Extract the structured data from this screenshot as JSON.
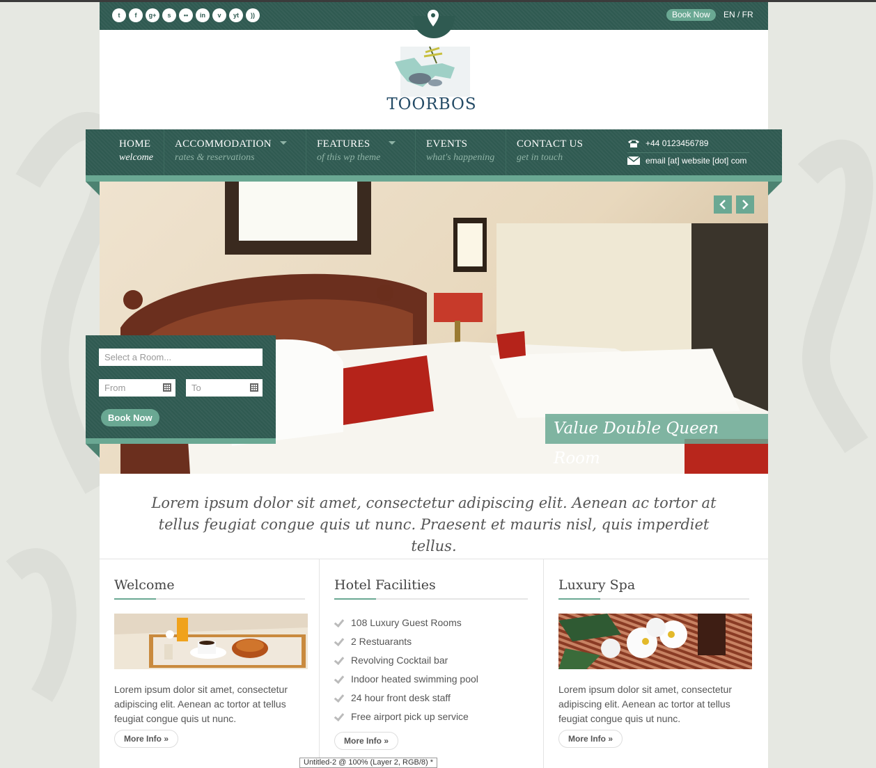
{
  "topbar": {
    "social": [
      {
        "icon": "twitter-icon",
        "glyph": "t"
      },
      {
        "icon": "facebook-icon",
        "glyph": "f"
      },
      {
        "icon": "google-plus-icon",
        "glyph": "g+"
      },
      {
        "icon": "skype-icon",
        "glyph": "s"
      },
      {
        "icon": "flickr-icon",
        "glyph": "••"
      },
      {
        "icon": "linkedin-icon",
        "glyph": "in"
      },
      {
        "icon": "vimeo-icon",
        "glyph": "v"
      },
      {
        "icon": "youtube-icon",
        "glyph": "yt"
      },
      {
        "icon": "rss-icon",
        "glyph": "))"
      }
    ],
    "book_now": "Book Now",
    "lang": "EN / FR"
  },
  "logo": {
    "text": "TOORBOS"
  },
  "nav": {
    "items": [
      {
        "title": "HOME",
        "subtitle": "welcome"
      },
      {
        "title": "ACCOMMODATION",
        "subtitle": "rates & reservations"
      },
      {
        "title": "FEATURES",
        "subtitle": "of this wp theme"
      },
      {
        "title": "EVENTS",
        "subtitle": "what's happening"
      },
      {
        "title": "CONTACT US",
        "subtitle": "get in touch"
      }
    ],
    "phone": "+44 0123456789",
    "email": "email [at] website [dot] com"
  },
  "hero": {
    "caption": "Value Double Queen Room"
  },
  "booking": {
    "room_placeholder": "Select a Room...",
    "from_placeholder": "From",
    "to_placeholder": "To",
    "button": "Book Now"
  },
  "intro": "Lorem ipsum dolor sit amet, consectetur adipiscing elit. Aenean ac tortor at tellus feugiat congue quis ut nunc. Praesent et mauris nisl, quis imperdiet tellus.",
  "columns": {
    "welcome": {
      "title": "Welcome",
      "text": "Lorem ipsum dolor sit amet, consectetur adipiscing elit. Aenean ac tortor at tellus feugiat congue quis ut nunc.",
      "more": "More Info »"
    },
    "facilities": {
      "title": "Hotel Facilities",
      "items": [
        "108 Luxury Guest Rooms",
        "2 Restuarants",
        "Revolving Cocktail bar",
        "Indoor heated swimming pool",
        "24 hour front desk staff",
        "Free airport pick up service"
      ],
      "more": "More Info »"
    },
    "spa": {
      "title": "Luxury Spa",
      "text": "Lorem ipsum dolor sit amet, consectetur adipiscing elit. Aenean ac tortor at tellus feugiat congue quis ut nunc.",
      "more": "More Info »"
    }
  },
  "tooltip": "Untitled-2 @ 100% (Layer 2, RGB/8) *",
  "colors": {
    "primary": "#2f5a51",
    "accent": "#6aa893"
  }
}
